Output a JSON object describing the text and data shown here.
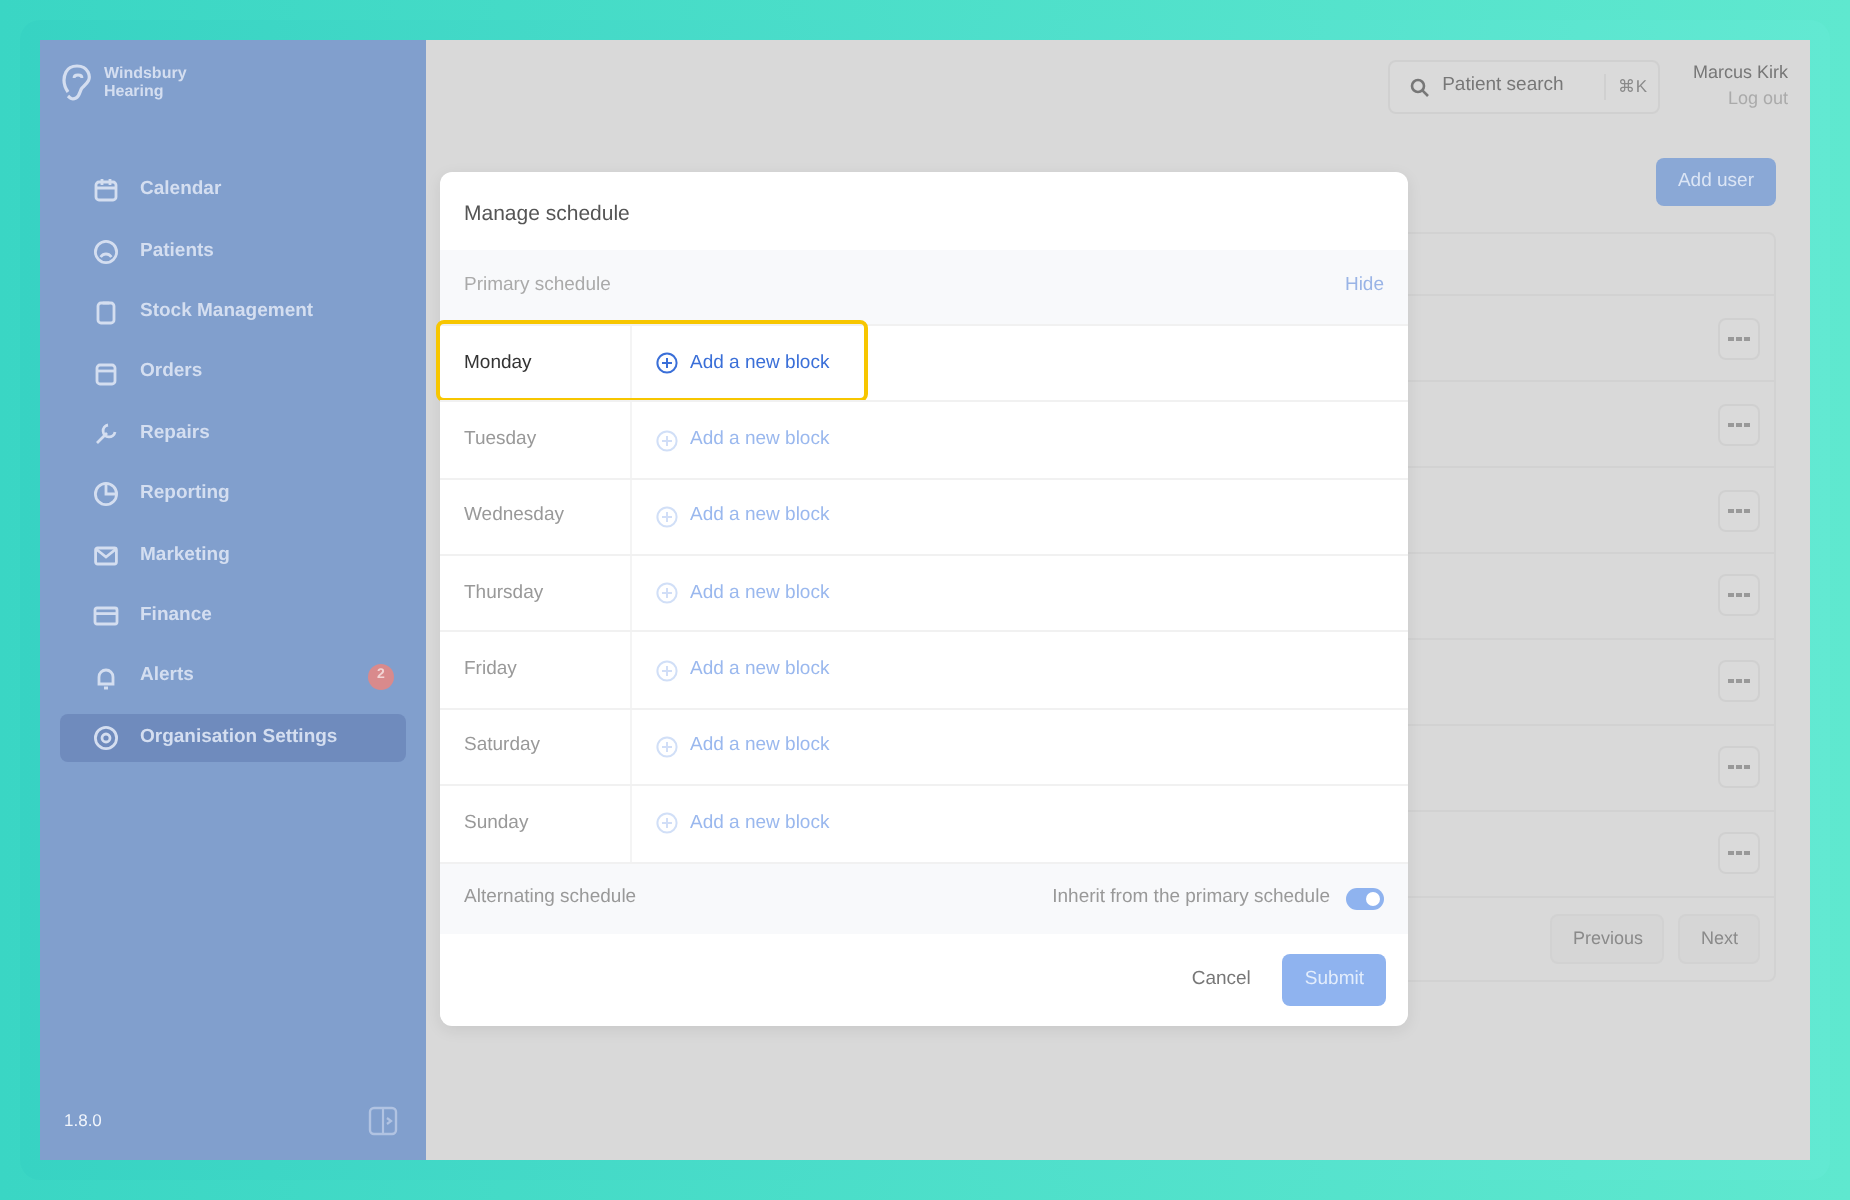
{
  "sidebar": {
    "logo": {
      "line_1": "Windsbury",
      "line_2": "Hearing"
    },
    "items": [
      {
        "label": "Calendar",
        "selected": false
      },
      {
        "label": "Patients",
        "selected": false
      },
      {
        "label": "Stock Management",
        "selected": false
      },
      {
        "label": "Orders",
        "selected": false
      },
      {
        "label": "Repairs",
        "selected": false
      },
      {
        "label": "Reporting",
        "selected": false
      },
      {
        "label": "Marketing",
        "selected": false
      },
      {
        "label": "Finance",
        "selected": false
      },
      {
        "label": "Alerts",
        "selected": false,
        "badge": "2"
      },
      {
        "label": "Organisation Settings",
        "selected": true
      }
    ],
    "version": "1.8.0"
  },
  "topbar": {
    "search": {
      "placeholder": "Patient search",
      "shortcut": "⌘K"
    },
    "user": {
      "name": "Marcus Kirk",
      "link": "Log out"
    }
  },
  "add_user_button": "Add user",
  "table": {
    "rows": [
      {
        "kind": "row"
      },
      {
        "kind": "row"
      },
      {
        "kind": "row"
      },
      {
        "kind": "row"
      },
      {
        "kind": "row"
      },
      {
        "kind": "row"
      },
      {
        "kind": "row"
      }
    ]
  },
  "pagination": [
    "Previous",
    "Next"
  ],
  "modal": {
    "title": "Manage schedule",
    "primary": {
      "label": "Primary schedule",
      "action": "Hide"
    },
    "days": [
      {
        "day": "Monday",
        "action": "Add a new block",
        "highlighted": true
      },
      {
        "day": "Tuesday",
        "action": "Add a new block",
        "highlighted": false
      },
      {
        "day": "Wednesday",
        "action": "Add a new block",
        "highlighted": false
      },
      {
        "day": "Thursday",
        "action": "Add a new block",
        "highlighted": false
      },
      {
        "day": "Friday",
        "action": "Add a new block",
        "highlighted": false
      },
      {
        "day": "Saturday",
        "action": "Add a new block",
        "highlighted": false
      },
      {
        "day": "Sunday",
        "action": "Add a new block",
        "highlighted": false
      }
    ],
    "alternating": {
      "label": "Alternating schedule",
      "toggle_label": "Inherit from the primary schedule",
      "on": true
    },
    "buttons": {
      "cancel": "Cancel",
      "submit": "Submit"
    }
  }
}
